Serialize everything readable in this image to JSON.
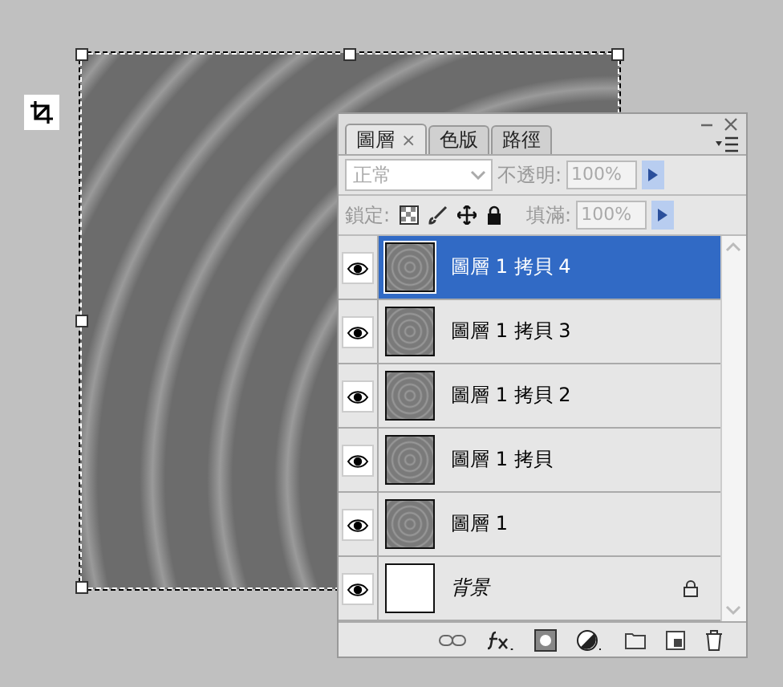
{
  "panel": {
    "tabs": [
      {
        "label": "圖層",
        "selected": true,
        "close": "×"
      },
      {
        "label": "色版",
        "selected": false
      },
      {
        "label": "路徑",
        "selected": false
      }
    ],
    "blend_mode": {
      "value": "正常",
      "disabled": true
    },
    "opacity": {
      "label": "不透明:",
      "value": "100%",
      "disabled": true
    },
    "lock": {
      "label": "鎖定:"
    },
    "fill": {
      "label": "填滿:",
      "value": "100%",
      "disabled": true
    },
    "layers": [
      {
        "name": "圖層 1 拷貝 4",
        "kind": "image",
        "selected": true,
        "visible": true,
        "locked": false
      },
      {
        "name": "圖層 1 拷貝 3",
        "kind": "image",
        "selected": false,
        "visible": true,
        "locked": false
      },
      {
        "name": "圖層 1 拷貝 2",
        "kind": "image",
        "selected": false,
        "visible": true,
        "locked": false
      },
      {
        "name": "圖層 1 拷貝",
        "kind": "image",
        "selected": false,
        "visible": true,
        "locked": false
      },
      {
        "name": "圖層 1",
        "kind": "image",
        "selected": false,
        "visible": true,
        "locked": false
      },
      {
        "name": "背景",
        "kind": "background",
        "selected": false,
        "visible": true,
        "locked": true
      }
    ]
  }
}
